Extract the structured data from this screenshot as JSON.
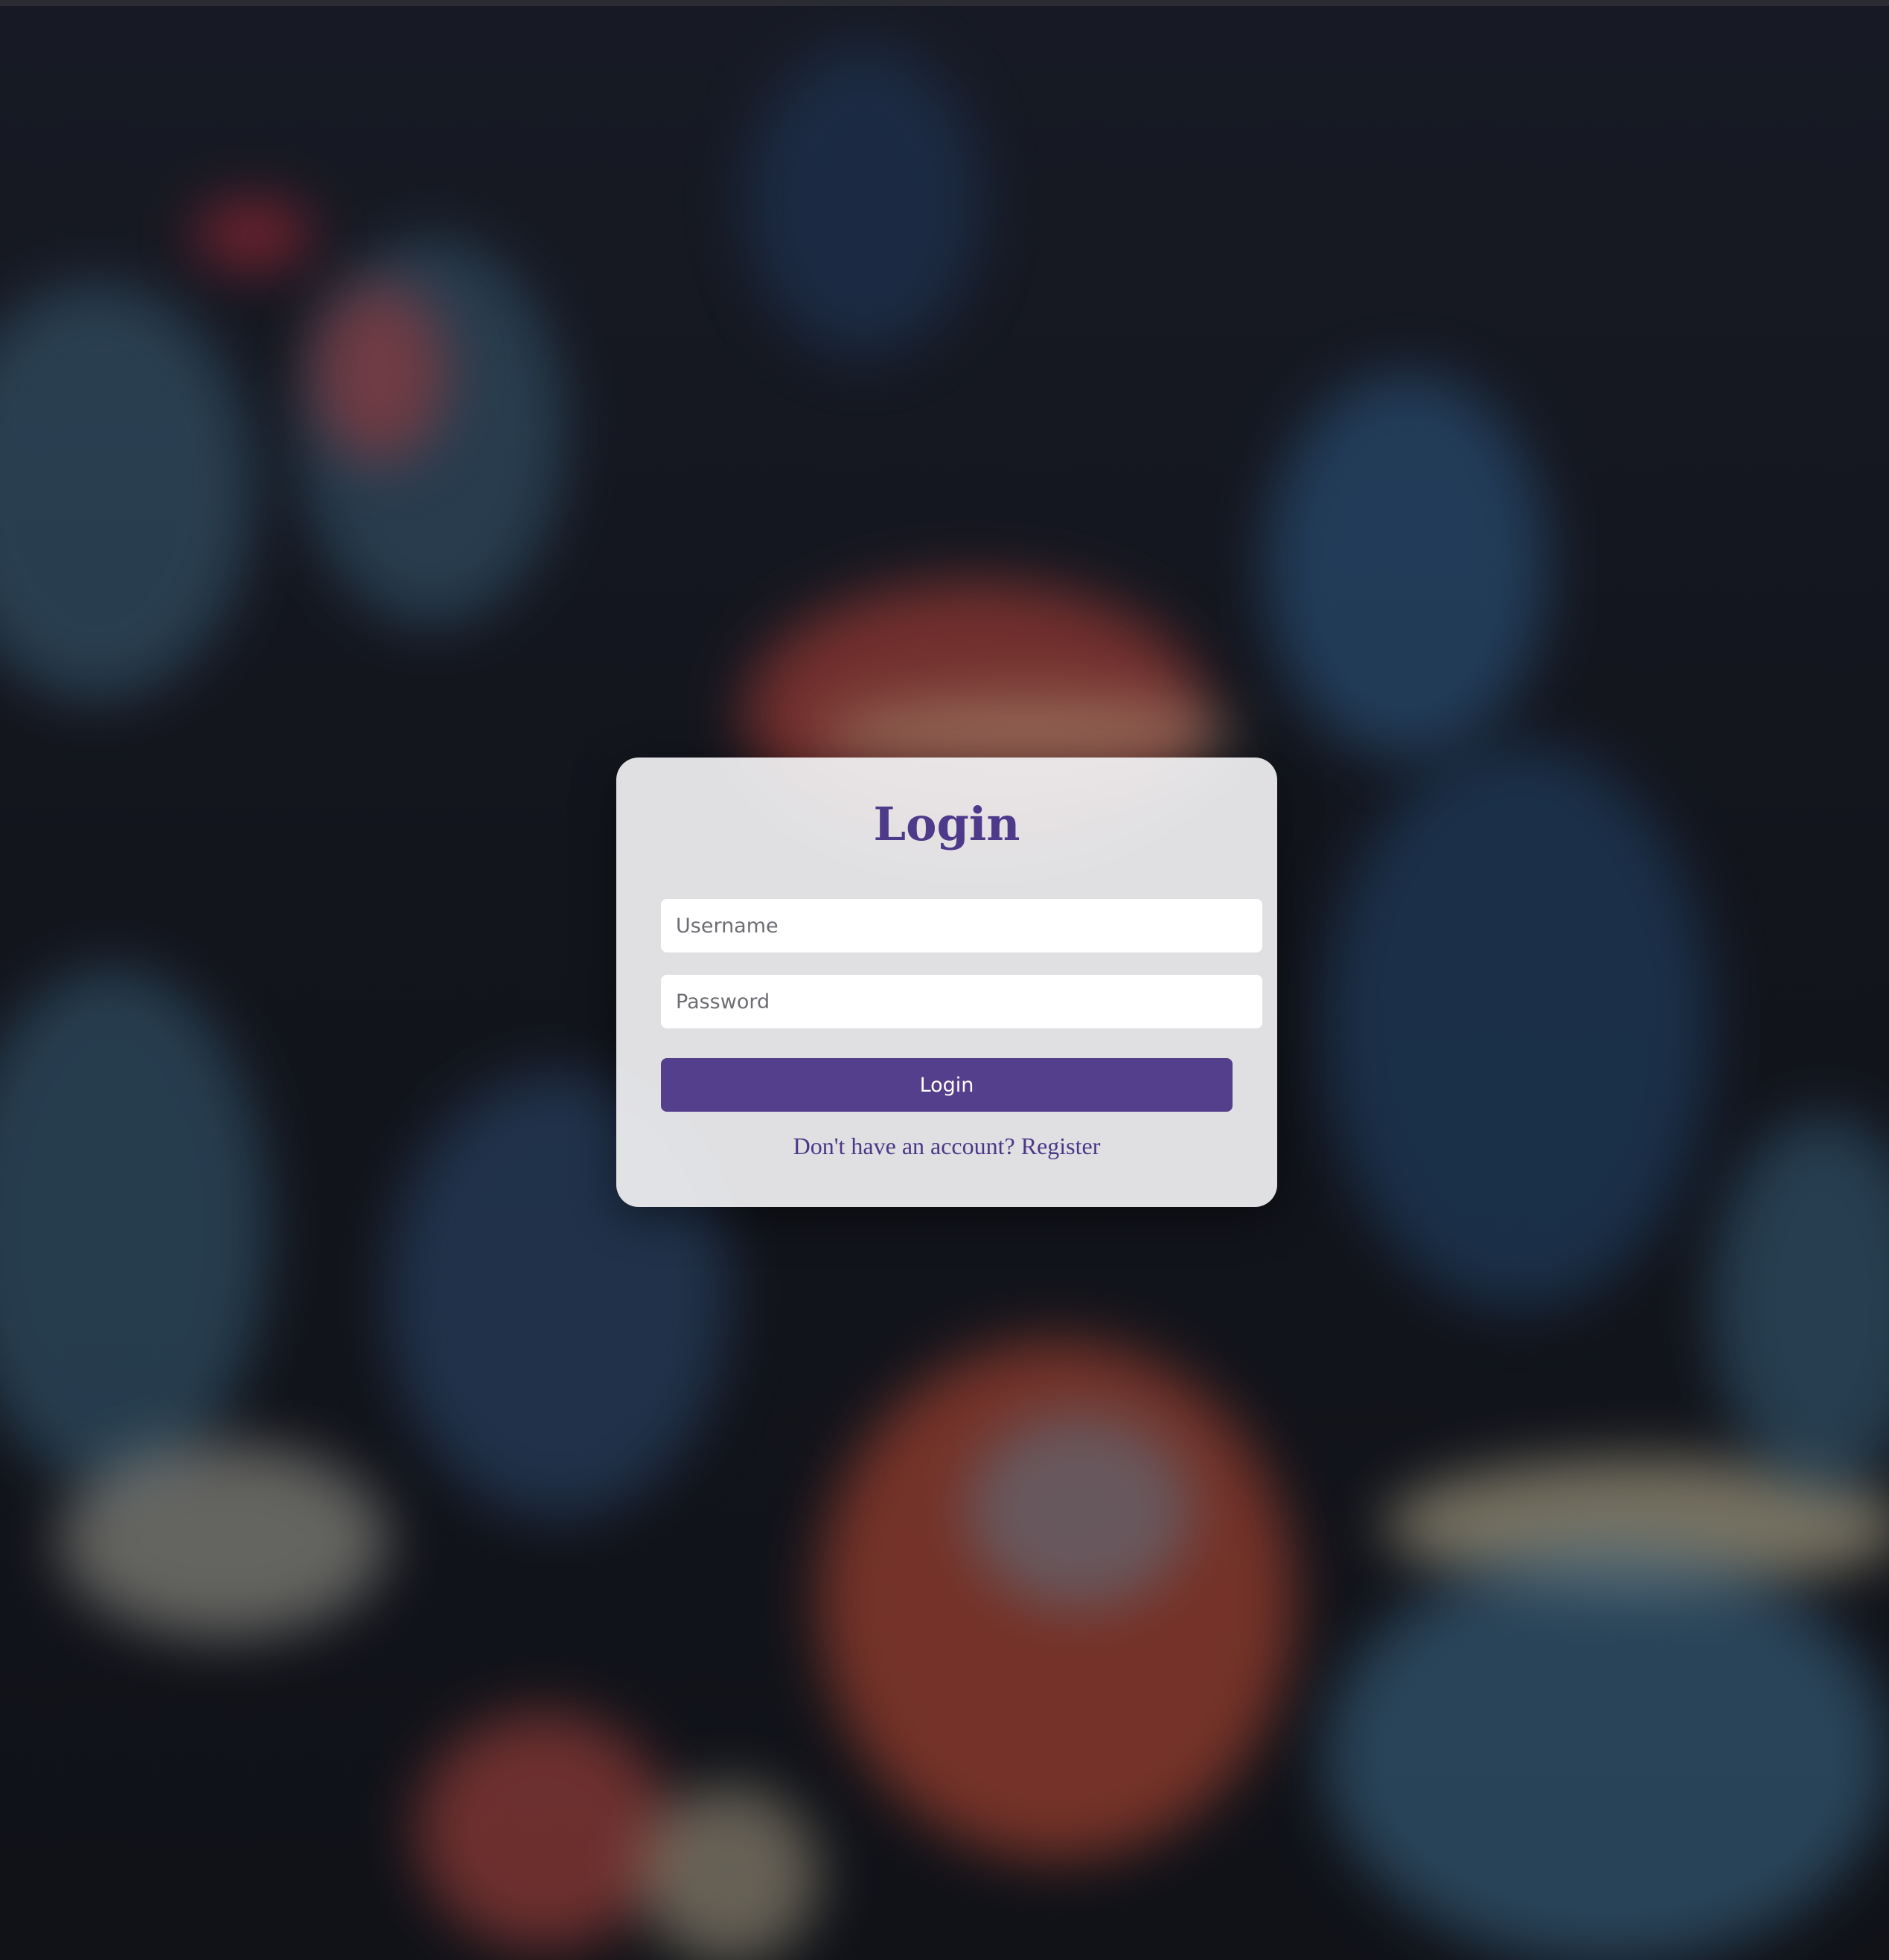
{
  "login_form": {
    "title": "Login",
    "username_placeholder": "Username",
    "password_placeholder": "Password",
    "submit_label": "Login",
    "register_prompt": "Don't have an account?",
    "register_link": "Register"
  },
  "colors": {
    "accent": "#533f8b",
    "title": "#4e3a8a",
    "card_background": "#f0f0f2"
  }
}
